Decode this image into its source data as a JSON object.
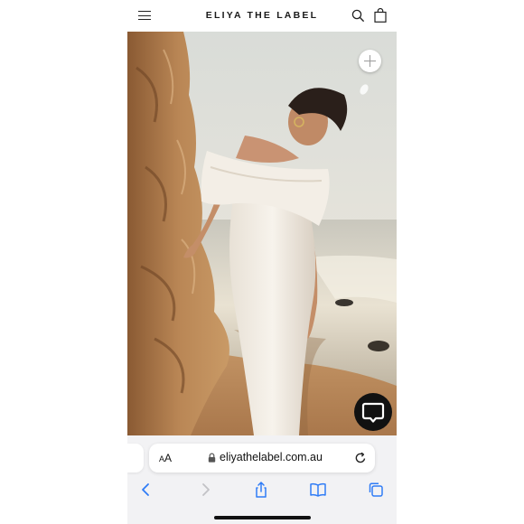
{
  "header": {
    "logo": "ELIYA THE LABEL",
    "menu_icon": "hamburger-menu-icon",
    "search_icon": "search-icon",
    "bag_icon": "shopping-bag-icon"
  },
  "hero": {
    "image": "model-white-off-shoulder-dress-beach-cliff",
    "zoom_icon": "plus-icon",
    "chat_icon": "chat-bubble-icon"
  },
  "browser": {
    "text_size_label_small": "A",
    "text_size_label_large": "A",
    "url": "eliyathelabel.com.au",
    "lock_icon": "lock-icon",
    "reload_icon": "reload-icon",
    "toolbar": [
      "back-icon",
      "forward-icon",
      "share-icon",
      "bookmarks-icon",
      "tabs-icon"
    ],
    "accent": "#2f7cf6",
    "disabled": "#c2c2c6"
  }
}
